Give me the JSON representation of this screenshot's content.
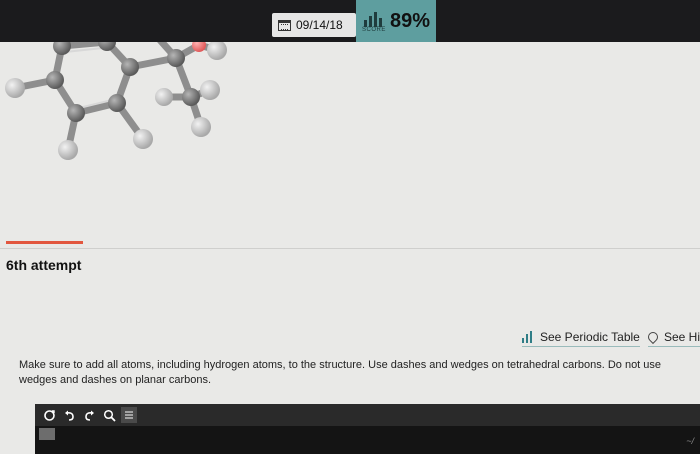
{
  "header": {
    "date": "09/14/18",
    "score": "89%",
    "score_caption": "SCORE"
  },
  "attempt_label": "6th attempt",
  "links": {
    "periodic_table": "See Periodic Table",
    "hint": "See Hi"
  },
  "instructions": "Make sure to add all atoms, including hydrogen atoms, to the structure. Use dashes and wedges on tetrahedral carbons. Do not use wedges and dashes on planar carbons.",
  "toolbar": {
    "tools": [
      "clear-icon",
      "undo-icon",
      "redo-icon",
      "zoom-icon",
      "tools-icon"
    ]
  },
  "colors": {
    "topbar": "#1b1b1d",
    "score_bg": "#5e9e9f",
    "accent": "#e2573f",
    "carbon": "#7a7a7a",
    "hydrogen": "#c9c9c9",
    "oxygen": "#f07b7b"
  }
}
